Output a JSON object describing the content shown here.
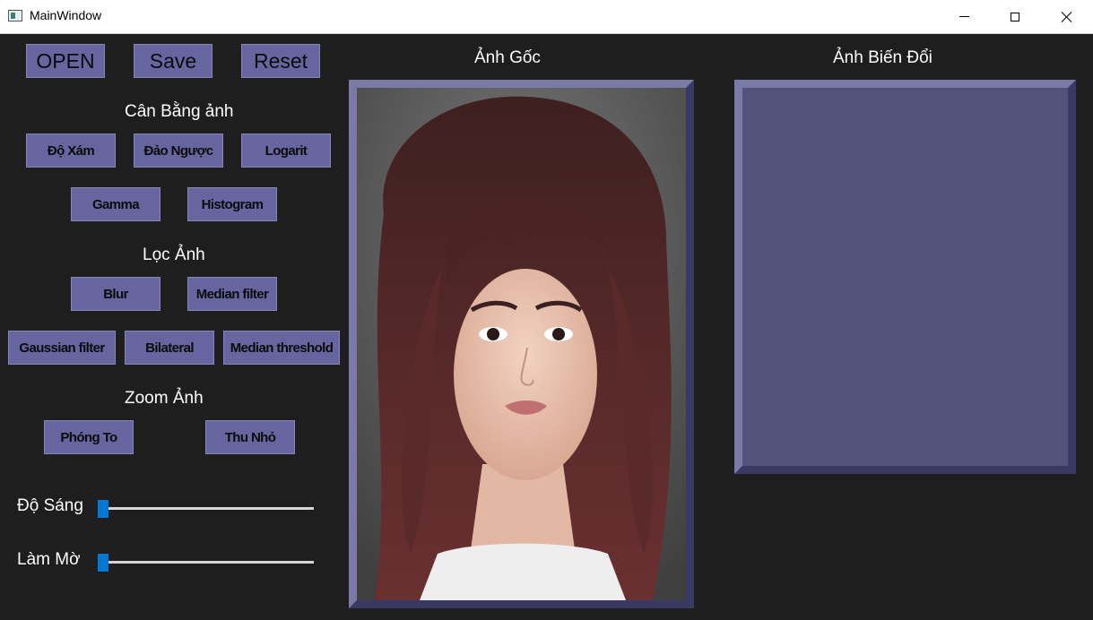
{
  "window": {
    "title": "MainWindow"
  },
  "toolbar": {
    "open_label": "OPEN",
    "save_label": "Save",
    "reset_label": "Reset"
  },
  "sections": {
    "balance": {
      "title": "Cân Bằng ảnh",
      "buttons": [
        "Độ Xám",
        "Đảo Ngược",
        "Logarit",
        "Gamma",
        "Histogram"
      ]
    },
    "filter": {
      "title": "Lọc Ảnh",
      "buttons": [
        "Blur",
        "Median filter",
        "Gaussian filter",
        "Bilateral",
        "Median threshold"
      ]
    },
    "zoom": {
      "title": "Zoom Ảnh",
      "buttons": [
        "Phóng To",
        "Thu Nhỏ"
      ]
    }
  },
  "sliders": [
    {
      "label": "Độ Sáng",
      "value": 0
    },
    {
      "label": "Làm Mờ",
      "value": 0
    }
  ],
  "panels": {
    "original_title": "Ảnh Gốc",
    "transformed_title": "Ảnh Biến Đổi"
  },
  "colors": {
    "background": "#1e1e1e",
    "button": "#67659f",
    "frame": "#52527a",
    "slider_handle": "#0078d4"
  },
  "icons": {
    "app": "app-window-icon",
    "minimize": "minimize-icon",
    "maximize": "maximize-icon",
    "close": "close-icon"
  }
}
